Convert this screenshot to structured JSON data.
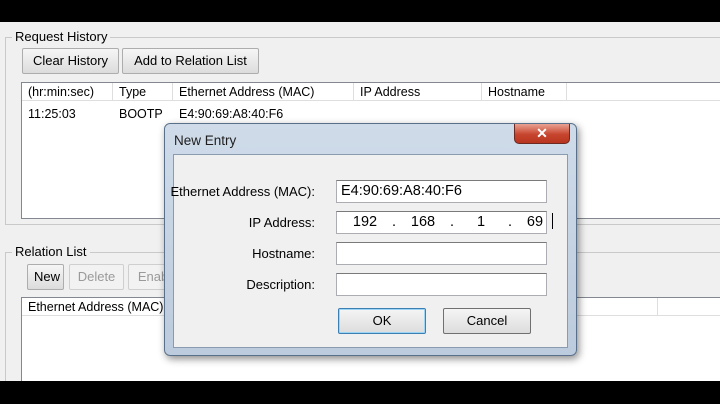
{
  "request_history": {
    "title": "Request History",
    "clear_label": "Clear History",
    "add_label": "Add to Relation List",
    "columns": [
      "(hr:min:sec)",
      "Type",
      "Ethernet Address (MAC)",
      "IP Address",
      "Hostname"
    ],
    "rows": [
      {
        "time": "11:25:03",
        "type": "BOOTP",
        "mac": "E4:90:69:A8:40:F6",
        "ip": "",
        "hostname": ""
      }
    ]
  },
  "relation_list": {
    "title": "Relation List",
    "new_label": "New",
    "delete_label": "Delete",
    "enable_label": "Enab",
    "columns": [
      "Ethernet Address (MAC)"
    ]
  },
  "dialog": {
    "title": "New Entry",
    "close_glyph": "✕",
    "fields": {
      "mac_label": "Ethernet Address (MAC):",
      "mac_value": "E4:90:69:A8:40:F6",
      "ip_label": "IP Address:",
      "ip_octets": [
        "192",
        "168",
        "1",
        "69"
      ],
      "ip_separator": ".",
      "hostname_label": "Hostname:",
      "hostname_value": "",
      "description_label": "Description:",
      "description_value": ""
    },
    "ok_label": "OK",
    "cancel_label": "Cancel"
  }
}
